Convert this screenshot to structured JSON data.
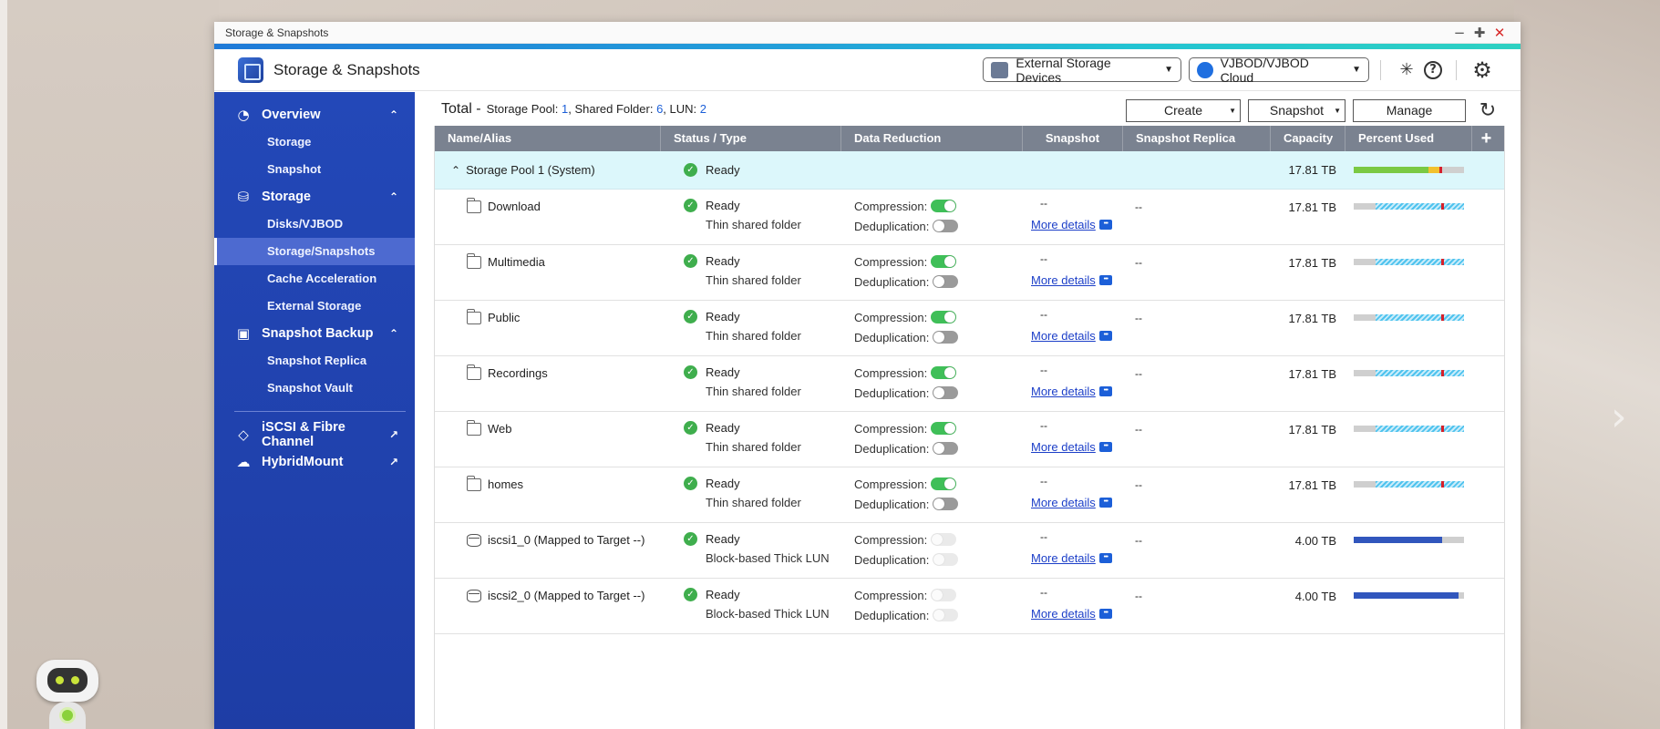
{
  "window": {
    "title": "Storage & Snapshots"
  },
  "app": {
    "title": "Storage & Snapshots",
    "external_storage_label": "External Storage Devices",
    "vjbod_label": "VJBOD/VJBOD Cloud"
  },
  "sidebar": {
    "groups": [
      {
        "label": "Overview",
        "items": [
          "Storage",
          "Snapshot"
        ]
      },
      {
        "label": "Storage",
        "items": [
          "Disks/VJBOD",
          "Storage/Snapshots",
          "Cache Acceleration",
          "External Storage"
        ]
      },
      {
        "label": "Snapshot Backup",
        "items": [
          "Snapshot Replica",
          "Snapshot Vault"
        ]
      }
    ],
    "active_item": "Storage/Snapshots",
    "links": [
      "iSCSI & Fibre Channel",
      "HybridMount"
    ]
  },
  "summary": {
    "total_label": "Total -",
    "pool_label": "Storage Pool:",
    "pool_count": "1",
    "folder_label": ", Shared Folder:",
    "folder_count": "6",
    "lun_label": ", LUN:",
    "lun_count": "2"
  },
  "toolbar": {
    "create": "Create",
    "snapshot": "Snapshot",
    "manage": "Manage"
  },
  "table": {
    "columns": [
      "Name/Alias",
      "Status / Type",
      "Data Reduction",
      "Snapshot",
      "Snapshot Replica",
      "Capacity",
      "Percent Used"
    ],
    "add_column_label": "+",
    "compression_label": "Compression:",
    "dedup_label": "Deduplication:",
    "more_details_label": "More details",
    "dash": "--",
    "pool": {
      "name": "Storage Pool 1 (System)",
      "status": "Ready",
      "capacity": "17.81 TB",
      "percent_used": 0.68,
      "reserved": 0.1
    },
    "rows": [
      {
        "name": "Download",
        "kind": "folder",
        "status": "Ready",
        "type": "Thin shared folder",
        "compression": "on",
        "dedup": "off",
        "capacity": "17.81 TB",
        "percent_used": 0.8
      },
      {
        "name": "Multimedia",
        "kind": "folder",
        "status": "Ready",
        "type": "Thin shared folder",
        "compression": "on",
        "dedup": "off",
        "capacity": "17.81 TB",
        "percent_used": 0.8
      },
      {
        "name": "Public",
        "kind": "folder",
        "status": "Ready",
        "type": "Thin shared folder",
        "compression": "on",
        "dedup": "off",
        "capacity": "17.81 TB",
        "percent_used": 0.8
      },
      {
        "name": "Recordings",
        "kind": "folder",
        "status": "Ready",
        "type": "Thin shared folder",
        "compression": "on",
        "dedup": "off",
        "capacity": "17.81 TB",
        "percent_used": 0.8
      },
      {
        "name": "Web",
        "kind": "folder",
        "status": "Ready",
        "type": "Thin shared folder",
        "compression": "on",
        "dedup": "off",
        "capacity": "17.81 TB",
        "percent_used": 0.8
      },
      {
        "name": "homes",
        "kind": "folder",
        "status": "Ready",
        "type": "Thin shared folder",
        "compression": "on",
        "dedup": "off",
        "capacity": "17.81 TB",
        "percent_used": 0.8
      },
      {
        "name": "iscsi1_0 (Mapped to Target --)",
        "kind": "lun",
        "status": "Ready",
        "type": "Block-based Thick LUN",
        "compression": "disabled",
        "dedup": "disabled",
        "capacity": "4.00 TB",
        "percent_used": 0.8
      },
      {
        "name": "iscsi2_0 (Mapped to Target --)",
        "kind": "lun",
        "status": "Ready",
        "type": "Block-based Thick LUN",
        "compression": "disabled",
        "dedup": "disabled",
        "capacity": "4.00 TB",
        "percent_used": 0.95
      }
    ]
  },
  "colors": {
    "accent": "#2348b8",
    "ok": "#3fae4d",
    "link": "#1c3fc8",
    "pool_row": "#dcf7fb"
  }
}
